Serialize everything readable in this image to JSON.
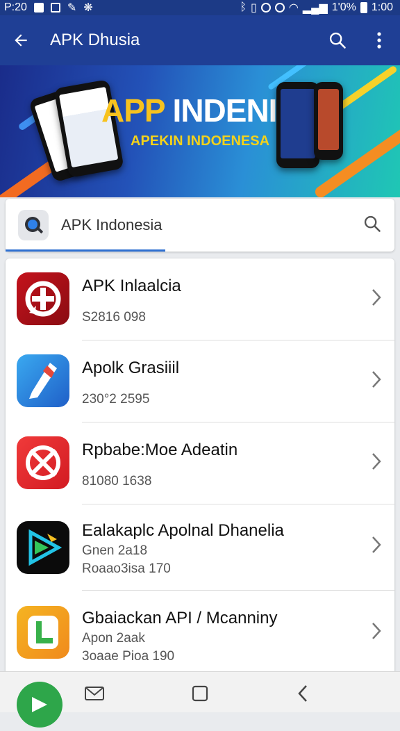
{
  "status_bar": {
    "time_left": "P:20",
    "battery": "1'0%",
    "time_right": "1:00"
  },
  "app_bar": {
    "title": "APK Dhusia",
    "back_icon": "back-arrow-icon",
    "search_icon": "search-icon",
    "menu_icon": "more-vert-icon"
  },
  "banner": {
    "title_part1": "APP",
    "title_part2": "INDENISIA",
    "subtitle": "APEKIN INDOENESA",
    "slides": 4,
    "active_slide": 1
  },
  "search": {
    "value": "APK Indonesia",
    "logo_icon": "app-logo-icon",
    "icon": "search-icon",
    "progress": 0.41
  },
  "apps": [
    {
      "name": "APK Inlaalcia",
      "meta1": "S2816  098",
      "meta2": "",
      "icon": "red-plus-icon",
      "colors": [
        "#c4121c",
        "#8a0c12"
      ]
    },
    {
      "name": "Apolk Grasiiil",
      "meta1": "230°2 2595",
      "meta2": "",
      "icon": "blue-knife-icon",
      "colors": [
        "#3aa9f0",
        "#1f5fc8"
      ]
    },
    {
      "name": "Rpbabe:Moe Adeatin",
      "meta1": "81080 1638",
      "meta2": "",
      "icon": "red-cross-icon",
      "colors": [
        "#f03a3a",
        "#d21b22"
      ]
    },
    {
      "name": "Ealakaplc Apolnal Dhanelia",
      "meta1": "Gnen 2a18",
      "meta2": "Roaao3isa 170",
      "icon": "play-icon",
      "colors": [
        "#111111",
        "#000000"
      ]
    },
    {
      "name": "Gbaiackan API / Mcanniny",
      "meta1": "Apon 2aak",
      "meta2": "3oaae Pioa 190",
      "icon": "green-l-icon",
      "colors": [
        "#f5b422",
        "#f08a1c"
      ]
    }
  ],
  "navbar": {
    "fab_icon": "green-fab-icon",
    "buttons": [
      "mail-icon",
      "home-icon",
      "back-icon"
    ]
  },
  "colors": {
    "primary": "#1f3f95",
    "accent": "#2d6fd1"
  }
}
